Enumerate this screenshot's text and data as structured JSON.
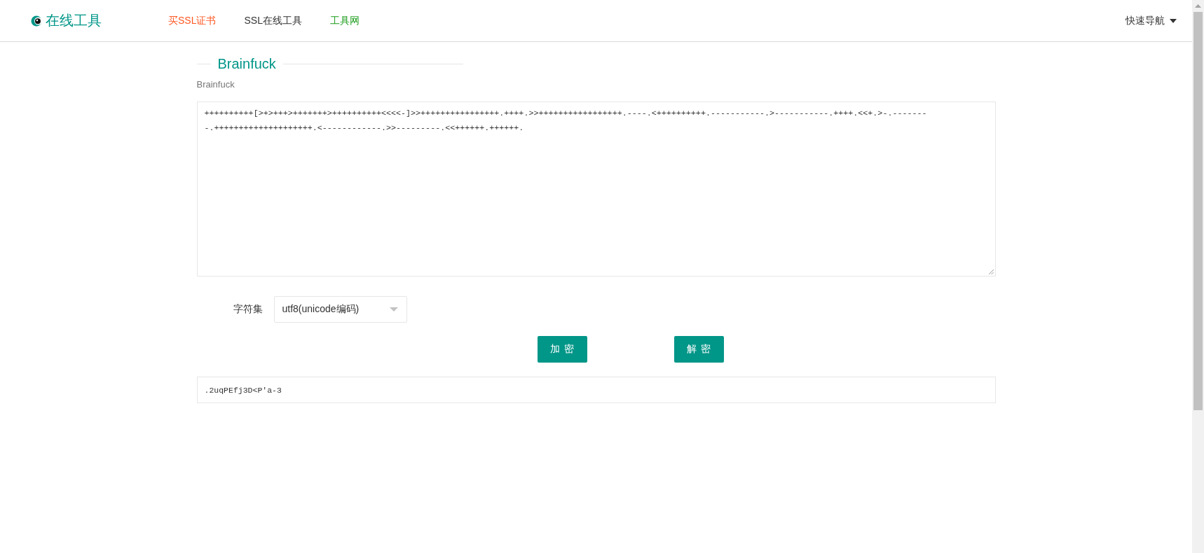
{
  "header": {
    "logo": {
      "text": "在线工具"
    },
    "nav": [
      {
        "label": "买SSL证书",
        "color": "#ff5722"
      },
      {
        "label": "SSL在线工具",
        "color": "#333333"
      },
      {
        "label": "工具网",
        "color": "#1e9e1e"
      }
    ],
    "quick_nav": {
      "label": "快速导航"
    }
  },
  "section": {
    "title": "Brainfuck",
    "subtitle": "Brainfuck"
  },
  "input": {
    "value": "++++++++++[>+>+++>+++++++>++++++++++<<<<-]>>++++++++++++++++.++++.>>+++++++++++++++++.----.<++++++++++.-----------.>-----------.++++.<<+.>-.--------.++++++++++++++++++++.<------------.>>---------.<<++++++.++++++."
  },
  "charset": {
    "label": "字符集",
    "value": "utf8(unicode编码)"
  },
  "buttons": [
    {
      "label": "加密"
    },
    {
      "label": "解密"
    }
  ],
  "output": {
    "value": ".2uqPEfj3D<P'a-3"
  }
}
